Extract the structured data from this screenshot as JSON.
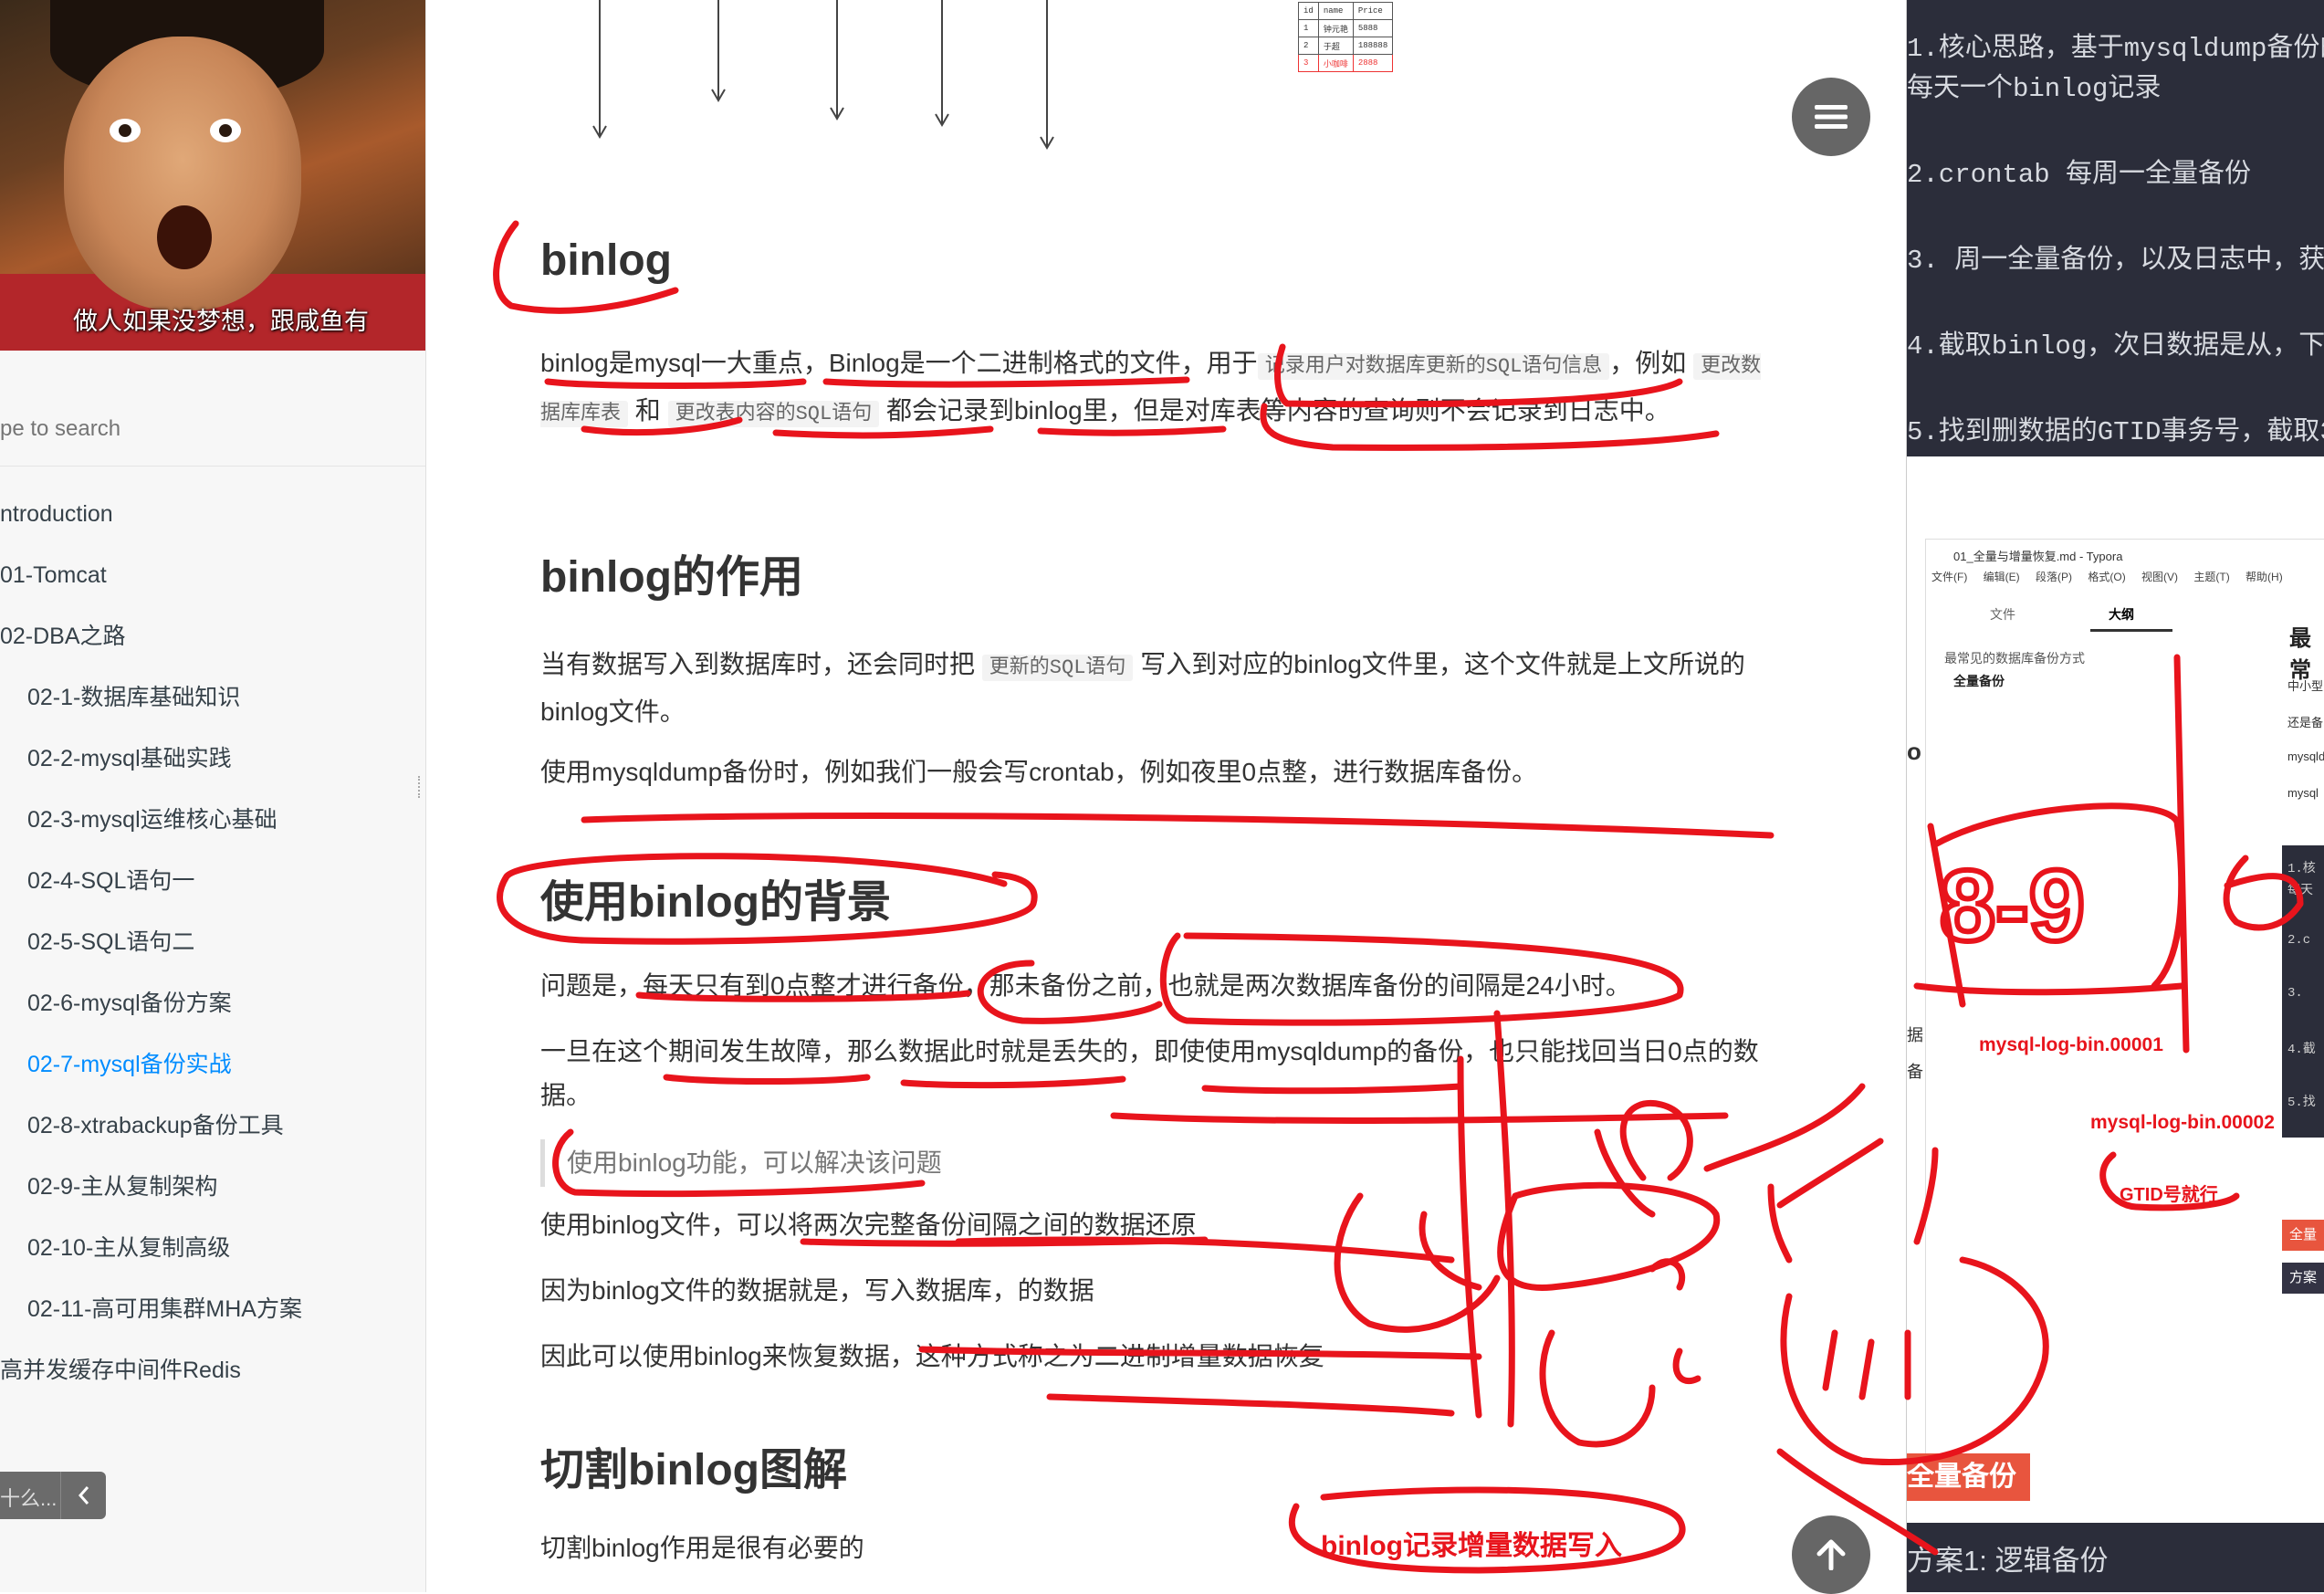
{
  "sidebar": {
    "avatar_caption": "做人如果没梦想，跟咸鱼有",
    "search_placeholder": "pe to search",
    "items": [
      {
        "label": "ntroduction"
      },
      {
        "label": "01-Tomcat"
      },
      {
        "label": "02-DBA之路"
      },
      {
        "label": "02-1-数据库基础知识"
      },
      {
        "label": "02-2-mysql基础实践"
      },
      {
        "label": "02-3-mysql运维核心基础"
      },
      {
        "label": "02-4-SQL语句一"
      },
      {
        "label": "02-5-SQL语句二"
      },
      {
        "label": "02-6-mysql备份方案"
      },
      {
        "label": "02-7-mysql备份实战"
      },
      {
        "label": "02-8-xtrabackup备份工具"
      },
      {
        "label": "02-9-主从复制架构"
      },
      {
        "label": "02-10-主从复制高级"
      },
      {
        "label": "02-11-高可用集群MHA方案"
      },
      {
        "label": "高并发缓存中间件Redis"
      }
    ],
    "toggle_text": "十么..."
  },
  "diagram": {
    "table": {
      "headers": [
        "id",
        "name",
        "Price"
      ],
      "rows": [
        [
          "1",
          "钟元艳",
          "5888"
        ],
        [
          "2",
          "于超",
          "188888"
        ],
        [
          "3",
          "小咖啡",
          "2888"
        ]
      ]
    }
  },
  "main": {
    "h_binlog": "binlog",
    "p1_a": "binlog是mysql一大重点，Binlog是一个二进制格式的文件，用于",
    "p1_code1": "记录用户对数据库更新的SQL语句信息",
    "p1_b": "，例如",
    "p1_code2": "更改数据库库表",
    "p1_c": "和",
    "p1_code3": "更改表内容的SQL语句",
    "p1_d": "都会记录到binlog里，但是对库表等内容的查询则不会记录到日志中。",
    "h_role": "binlog的作用",
    "p2_a": "当有数据写入到数据库时，还会同时把",
    "p2_code": "更新的SQL语句",
    "p2_b": "写入到对应的binlog文件里，这个文件就是上文所说的binlog文件。",
    "p3": "使用mysqldump备份时，例如我们一般会写crontab，例如夜里0点整，进行数据库备份。",
    "h_bg": "使用binlog的背景",
    "p4": "问题是，每天只有到0点整才进行备份，那未备份之前，也就是两次数据库备份的间隔是24小时。",
    "p5": "一旦在这个期间发生故障，那么数据此时就是丢失的，即使使用mysqldump的备份，也只能找回当日0点的数据。",
    "quote": "使用binlog功能，可以解决该问题",
    "p6": "使用binlog文件，可以将两次完整备份间隔之间的数据还原",
    "p7": "因为binlog文件的数据就是，写入数据库，的数据",
    "p8": "因此可以使用binlog来恢复数据，这种方式称之为二进制增量数据恢复",
    "h_cut": "切割binlog图解",
    "p9": "切割binlog作用是很有必要的"
  },
  "right": {
    "lines": [
      "1.核心思路，基于mysqldump备份的",
      "每天一个binlog记录",
      "2.crontab 每周一全量备份",
      "3. 周一全量备份，以及日志中，获",
      "4.截取binlog，次日数据是从，下一",
      "5.找到删数据的GTID事务号，截取3"
    ],
    "typora": {
      "title": "01_全量与增量恢复.md - Typora",
      "menu": [
        "文件(F)",
        "编辑(E)",
        "段落(P)",
        "格式(O)",
        "视图(V)",
        "主题(T)",
        "帮助(H)"
      ],
      "tab_file": "文件",
      "tab_outline": "大纲",
      "outline_1": "最常见的数据库备份方式",
      "outline_2": "全量备份",
      "doc_title": "最常",
      "doc_lines": [
        "中小型",
        "还是备",
        "mysqld",
        "mysql"
      ],
      "dark_lines": [
        "1.核",
        "每天",
        "2.c",
        "3.",
        "4.截",
        "5.找"
      ],
      "badge1": "全量",
      "badge2": "方案",
      "small_o": "o",
      "side1": "据",
      "side2": "备"
    },
    "badge": "全量备份",
    "bottom_text": "方案1: 逻辑备份"
  },
  "annotations": {
    "log1": "mysql-log-bin.00001",
    "log2": "mysql-log-bin.00002",
    "gtid": "GTID号就行",
    "write": "binlog记录增量数据写入",
    "range": "8-9"
  }
}
